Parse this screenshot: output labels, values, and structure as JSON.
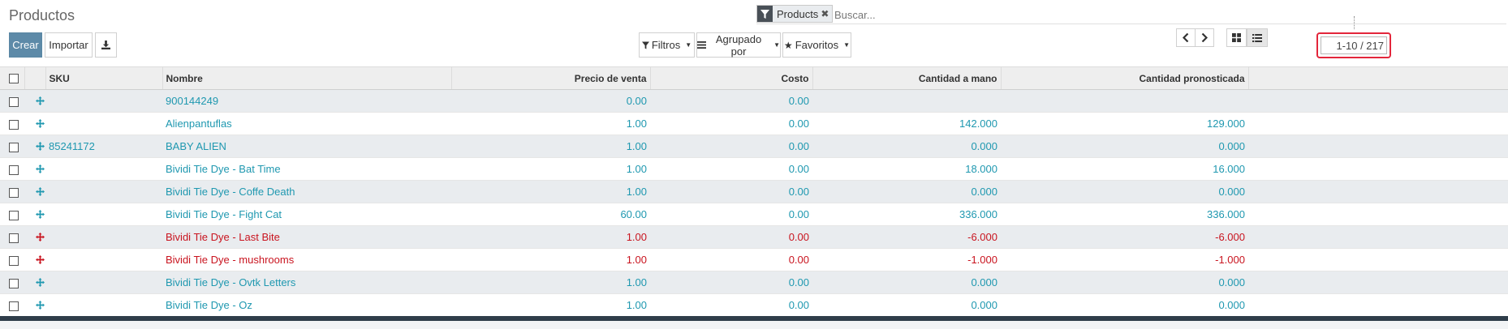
{
  "page": {
    "title": "Productos"
  },
  "search": {
    "facet_value": "Products",
    "facet_remove": "✖",
    "placeholder": "Buscar..."
  },
  "buttons": {
    "create": "Crear",
    "import": "Importar",
    "filters": "Filtros",
    "group_by": "Agrupado por",
    "favorites": "Favoritos"
  },
  "pager": {
    "value": "1-10 / 217"
  },
  "table": {
    "headers": {
      "sku": "SKU",
      "name": "Nombre",
      "sale_price": "Precio de venta",
      "cost": "Costo",
      "qty_on_hand": "Cantidad a mano",
      "qty_forecast": "Cantidad pronosticada"
    },
    "rows": [
      {
        "sku": "",
        "name": "900144249",
        "sale_price": "0.00",
        "cost": "0.00",
        "qty_on_hand": "",
        "qty_forecast": "",
        "status": "normal"
      },
      {
        "sku": "",
        "name": "Alienpantuflas",
        "sale_price": "1.00",
        "cost": "0.00",
        "qty_on_hand": "142.000",
        "qty_forecast": "129.000",
        "status": "normal"
      },
      {
        "sku": "85241172",
        "name": "BABY ALIEN",
        "sale_price": "1.00",
        "cost": "0.00",
        "qty_on_hand": "0.000",
        "qty_forecast": "0.000",
        "status": "normal"
      },
      {
        "sku": "",
        "name": "Bividi Tie Dye - Bat Time",
        "sale_price": "1.00",
        "cost": "0.00",
        "qty_on_hand": "18.000",
        "qty_forecast": "16.000",
        "status": "normal"
      },
      {
        "sku": "",
        "name": "Bividi Tie Dye - Coffe Death",
        "sale_price": "1.00",
        "cost": "0.00",
        "qty_on_hand": "0.000",
        "qty_forecast": "0.000",
        "status": "normal"
      },
      {
        "sku": "",
        "name": "Bividi Tie Dye - Fight Cat",
        "sale_price": "60.00",
        "cost": "0.00",
        "qty_on_hand": "336.000",
        "qty_forecast": "336.000",
        "status": "normal"
      },
      {
        "sku": "",
        "name": "Bividi Tie Dye - Last Bite",
        "sale_price": "1.00",
        "cost": "0.00",
        "qty_on_hand": "-6.000",
        "qty_forecast": "-6.000",
        "status": "danger"
      },
      {
        "sku": "",
        "name": "Bividi Tie Dye - mushrooms",
        "sale_price": "1.00",
        "cost": "0.00",
        "qty_on_hand": "-1.000",
        "qty_forecast": "-1.000",
        "status": "danger"
      },
      {
        "sku": "",
        "name": "Bividi Tie Dye - Ovtk Letters",
        "sale_price": "1.00",
        "cost": "0.00",
        "qty_on_hand": "0.000",
        "qty_forecast": "0.000",
        "status": "normal"
      },
      {
        "sku": "",
        "name": "Bividi Tie Dye - Oz",
        "sale_price": "1.00",
        "cost": "0.00",
        "qty_on_hand": "0.000",
        "qty_forecast": "0.000",
        "status": "normal"
      }
    ]
  },
  "colors": {
    "primary": "#5d8aa8",
    "link": "#1f98b0",
    "danger": "#c9141f",
    "pager_highlight": "#e3263b"
  },
  "icons": {
    "facet": "filter-icon",
    "download": "download-icon",
    "filters": "filter-icon",
    "group_by": "bars-icon",
    "favorites": "star-icon",
    "prev": "chevron-left-icon",
    "next": "chevron-right-icon",
    "kanban_view": "kanban-view-icon",
    "list_view": "list-view-icon",
    "row_handle": "drag-handle-icon"
  }
}
